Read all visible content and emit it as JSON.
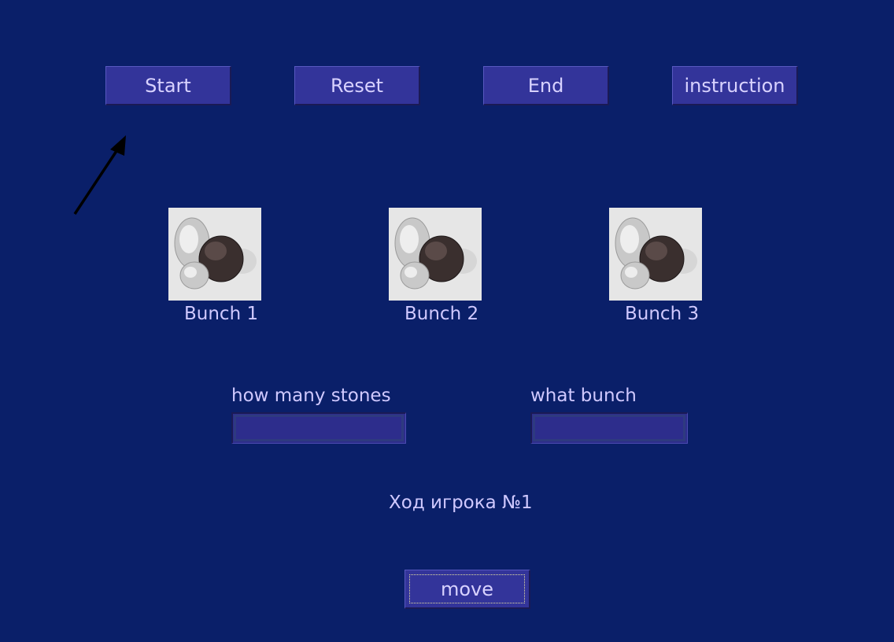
{
  "toolbar": {
    "start_label": "Start",
    "reset_label": "Reset",
    "end_label": "End",
    "instruction_label": "instruction"
  },
  "bunches": [
    {
      "label": "Bunch 1",
      "icon": "stones-icon"
    },
    {
      "label": "Bunch 2",
      "icon": "stones-icon"
    },
    {
      "label": "Bunch 3",
      "icon": "stones-icon"
    }
  ],
  "form": {
    "stones_label": "how many stones",
    "stones_value": "",
    "bunch_label": "what bunch",
    "bunch_value": ""
  },
  "status": {
    "turn_text": "Ход игрока №1"
  },
  "actions": {
    "move_label": "move"
  },
  "colors": {
    "background": "#0a1f69",
    "button": "#33349a",
    "text": "#d0c9ff"
  }
}
